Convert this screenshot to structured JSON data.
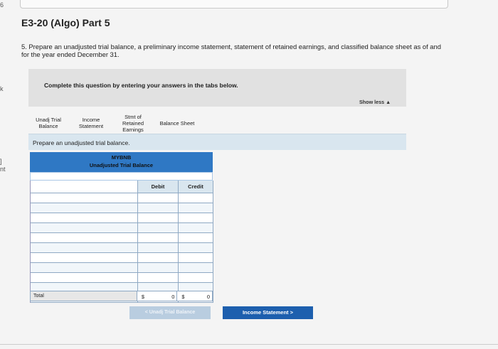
{
  "margin_marks": [
    "6",
    "k",
    "]",
    "nt"
  ],
  "title": "E3-20 (Algo) Part 5",
  "question": "5. Prepare an unadjusted trial balance, a preliminary income statement, statement of retained earnings, and classified balance sheet as of and for the year ended December 31.",
  "instruction": "Complete this question by entering your answers in the tabs below.",
  "show_less": "Show less ▲",
  "tabs": [
    {
      "line1": "Unadj Trial",
      "line2": "Balance",
      "line3": ""
    },
    {
      "line1": "Income",
      "line2": "Statement",
      "line3": ""
    },
    {
      "line1": "Stmt of",
      "line2": "Retained",
      "line3": "Earnings"
    },
    {
      "line1": "Balance Sheet",
      "line2": "",
      "line3": ""
    }
  ],
  "tab_prompt": "Prepare an unadjusted trial balance.",
  "table": {
    "company": "MYBNB",
    "title": "Unadjusted Trial Balance",
    "debit_header": "Debit",
    "credit_header": "Credit",
    "total_label": "Total",
    "debit_currency": "$",
    "debit_total": "0",
    "credit_currency": "$",
    "credit_total": "0"
  },
  "nav": {
    "prev_label": "< Unadj Trial Balance",
    "next_label": "Income Statement  >"
  }
}
